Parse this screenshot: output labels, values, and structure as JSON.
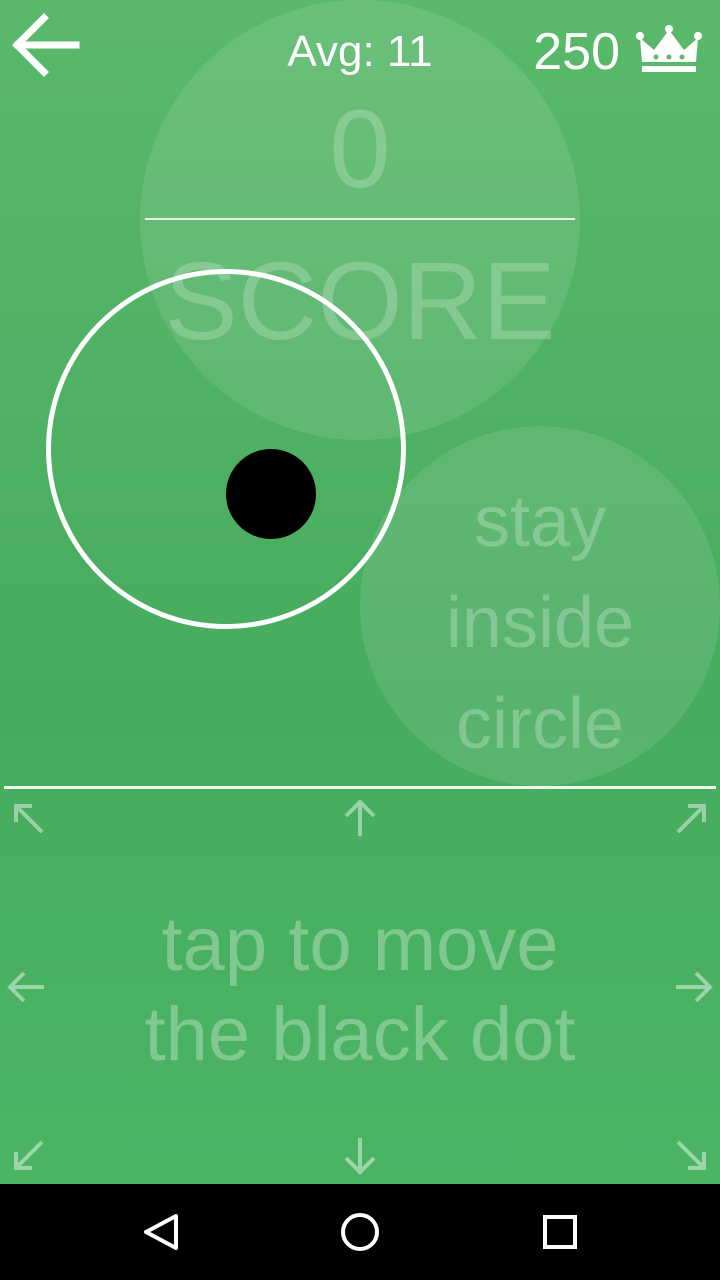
{
  "header": {
    "avg_text": "Avg: 11",
    "best_score": "250",
    "back_icon": "arrow-left-icon",
    "crown_icon": "crown-icon"
  },
  "score": {
    "value": "0",
    "label": "SCORE"
  },
  "hint": {
    "lines": [
      "stay",
      "inside",
      "circle"
    ]
  },
  "instruction": {
    "lines": [
      "tap to move",
      "the black dot"
    ]
  },
  "direction_arrows": [
    "up-left",
    "up",
    "up-right",
    "left",
    "right",
    "down-left",
    "down",
    "down-right"
  ],
  "navbar": {
    "buttons": [
      "back-triangle-icon",
      "home-circle-icon",
      "recents-square-icon"
    ]
  },
  "colors": {
    "background": "#4caf61",
    "circle": "#ffffff",
    "dot": "#000000",
    "navbar": "#000000"
  }
}
